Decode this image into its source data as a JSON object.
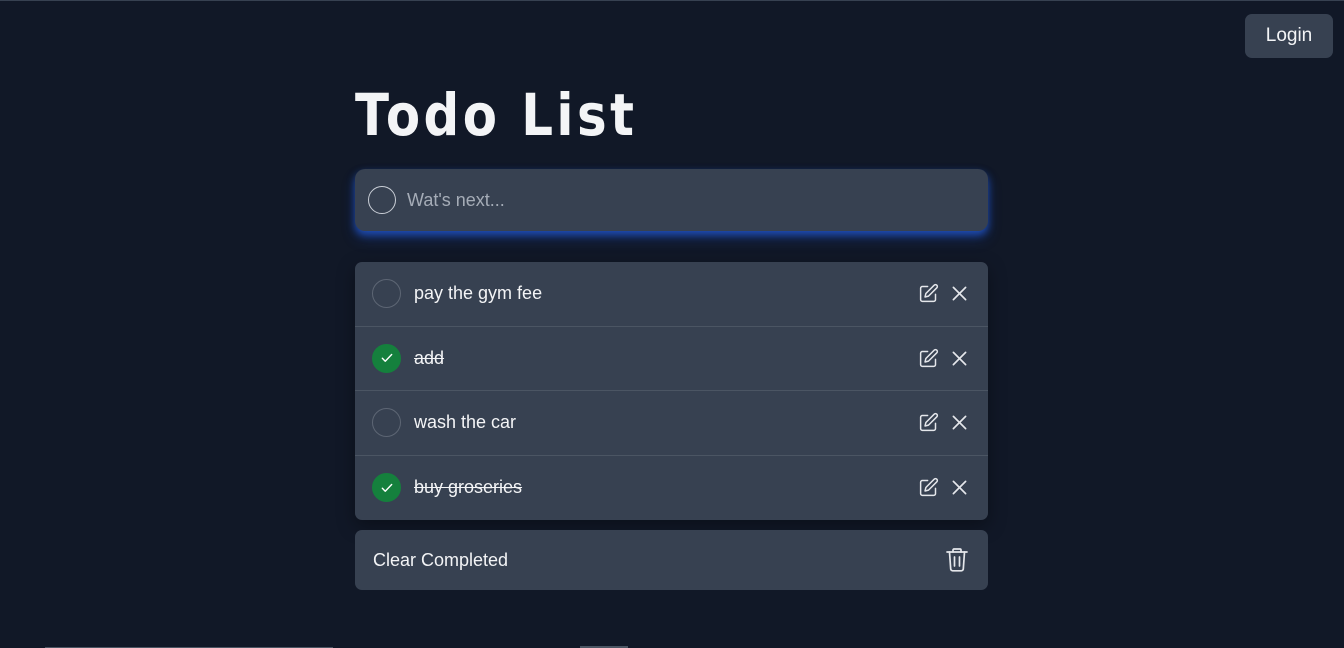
{
  "header": {
    "login_label": "Login"
  },
  "app": {
    "title": "Todo List"
  },
  "new_todo": {
    "placeholder": "Wat's next...",
    "value": ""
  },
  "todos": [
    {
      "text": "pay the gym fee",
      "completed": false
    },
    {
      "text": "add",
      "completed": true
    },
    {
      "text": "wash the car",
      "completed": false
    },
    {
      "text": "buy groseries",
      "completed": true
    }
  ],
  "footer": {
    "clear_label": "Clear Completed"
  },
  "colors": {
    "background": "#111827",
    "card": "#374151",
    "completed_check": "#15803d",
    "input_glow": "#2563eb"
  }
}
